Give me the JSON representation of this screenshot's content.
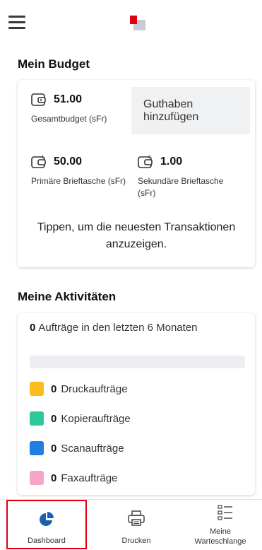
{
  "header": {
    "menu_icon": "hamburger-menu-icon",
    "logo_icon": "brand-logo-icon",
    "logo_colors": [
      "#e3000f",
      "#c9ccd6"
    ]
  },
  "budget": {
    "title": "Mein Budget",
    "total": {
      "amount": "51.00",
      "label": "Gesamtbudget  (sFr)"
    },
    "add_button": "Guthaben hinzufügen",
    "primary": {
      "amount": "50.00",
      "label": "Primäre Brieftasche (sFr)"
    },
    "secondary": {
      "amount": "1.00",
      "label": "Sekundäre Brieftasche (sFr)"
    },
    "hint": "Tippen, um die neuesten Transaktionen anzuzeigen."
  },
  "activities": {
    "title": "Meine Aktivitäten",
    "summary_count": "0",
    "summary_text": "Aufträge in den letzten 6 Monaten",
    "jobs": [
      {
        "count": "0",
        "label": "Druckaufträge",
        "color": "#f9be1c"
      },
      {
        "count": "0",
        "label": "Kopieraufträge",
        "color": "#2ec99a"
      },
      {
        "count": "0",
        "label": "Scanaufträge",
        "color": "#1f7fe0"
      },
      {
        "count": "0",
        "label": "Faxaufträge",
        "color": "#f6a5c7"
      }
    ]
  },
  "nav": {
    "dashboard": "Dashboard",
    "print": "Drucken",
    "queue": "Meine Warteschlange",
    "active_color": "#e00010",
    "accent": "#1a5fb4"
  }
}
